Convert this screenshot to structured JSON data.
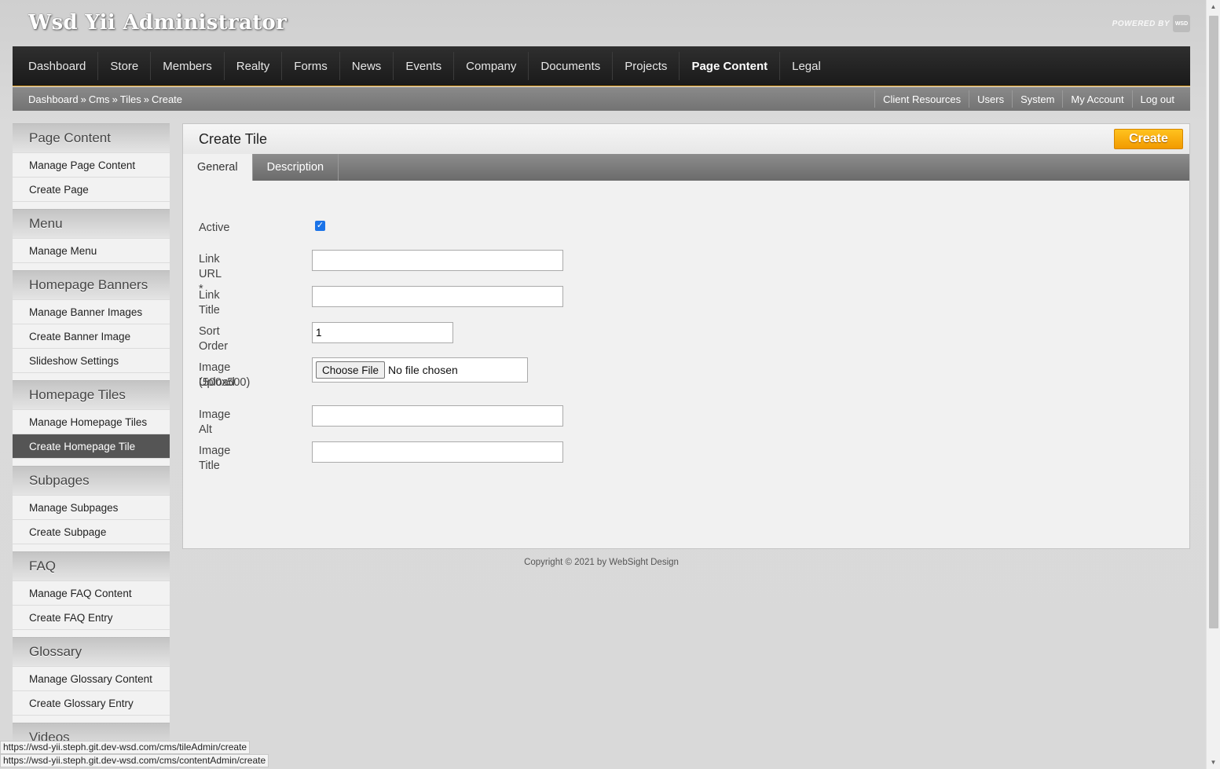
{
  "app": {
    "title": "Wsd Yii Administrator",
    "powered_by": "POWERED BY",
    "logo_text": "WSD"
  },
  "nav": {
    "items": [
      {
        "label": "Dashboard"
      },
      {
        "label": "Store"
      },
      {
        "label": "Members"
      },
      {
        "label": "Realty"
      },
      {
        "label": "Forms"
      },
      {
        "label": "News"
      },
      {
        "label": "Events"
      },
      {
        "label": "Company"
      },
      {
        "label": "Documents"
      },
      {
        "label": "Projects"
      },
      {
        "label": "Page Content"
      },
      {
        "label": "Legal"
      }
    ],
    "active": "Page Content"
  },
  "breadcrumb": {
    "items": [
      "Dashboard",
      "Cms",
      "Tiles",
      "Create"
    ],
    "separator": "»"
  },
  "util_links": [
    "Client Resources",
    "Users",
    "System",
    "My Account",
    "Log out"
  ],
  "sidebar": {
    "sections": [
      {
        "title": "Page Content",
        "items": [
          "Manage Page Content",
          "Create Page"
        ]
      },
      {
        "title": "Menu",
        "items": [
          "Manage Menu"
        ]
      },
      {
        "title": "Homepage Banners",
        "items": [
          "Manage Banner Images",
          "Create Banner Image",
          "Slideshow Settings"
        ]
      },
      {
        "title": "Homepage Tiles",
        "items": [
          "Manage Homepage Tiles",
          "Create Homepage Tile"
        ]
      },
      {
        "title": "Subpages",
        "items": [
          "Manage Subpages",
          "Create Subpage"
        ]
      },
      {
        "title": "FAQ",
        "items": [
          "Manage FAQ Content",
          "Create FAQ Entry"
        ]
      },
      {
        "title": "Glossary",
        "items": [
          "Manage Glossary Content",
          "Create Glossary Entry"
        ]
      },
      {
        "title": "Videos",
        "items": []
      }
    ],
    "active_item": "Create Homepage Tile"
  },
  "panel": {
    "title": "Create Tile",
    "create_label": "Create",
    "tabs": [
      {
        "label": "General"
      },
      {
        "label": "Description"
      }
    ],
    "active_tab": "General"
  },
  "form": {
    "active": {
      "label": "Active",
      "checked": true,
      "check_glyph": "✓"
    },
    "link_url": {
      "label": "Link URL *",
      "value": ""
    },
    "link_title": {
      "label": "Link Title",
      "value": ""
    },
    "sort_order": {
      "label": "Sort Order",
      "value": "1"
    },
    "image_upload": {
      "label": "Image Upload",
      "label_sub": "(500x500)",
      "button": "Choose File",
      "status": "No file chosen"
    },
    "image_alt": {
      "label": "Image Alt",
      "value": ""
    },
    "image_title": {
      "label": "Image Title",
      "value": ""
    }
  },
  "footer": {
    "copyright": "Copyright © 2021 by WebSight Design"
  },
  "status_bar": {
    "url_1": "https://wsd-yii.steph.git.dev-wsd.com/cms/tileAdmin/create",
    "url_2": "https://wsd-yii.steph.git.dev-wsd.com/cms/contentAdmin/create"
  },
  "colors": {
    "accent": "#f29a00",
    "nav_bg": "#1a1a1a",
    "checkbox": "#1a73e8",
    "active_side": "#555555"
  }
}
